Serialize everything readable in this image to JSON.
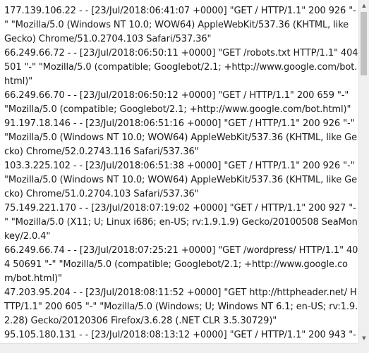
{
  "log": {
    "entries": [
      "177.139.106.22 - - [23/Jul/2018:06:41:07 +0000] \"GET / HTTP/1.1\" 200 926 \"-\" \"Mozilla/5.0 (Windows NT 10.0; WOW64) AppleWebKit/537.36 (KHTML, like Gecko) Chrome/51.0.2704.103 Safari/537.36\"",
      "66.249.66.72 - - [23/Jul/2018:06:50:11 +0000] \"GET /robots.txt HTTP/1.1\" 404 501 \"-\" \"Mozilla/5.0 (compatible; Googlebot/2.1; +http://www.google.com/bot.html)\"",
      "66.249.66.70 - - [23/Jul/2018:06:50:12 +0000] \"GET / HTTP/1.1\" 200 659 \"-\" \"Mozilla/5.0 (compatible; Googlebot/2.1; +http://www.google.com/bot.html)\"",
      "91.197.18.146 - - [23/Jul/2018:06:51:16 +0000] \"GET / HTTP/1.1\" 200 926 \"-\" \"Mozilla/5.0 (Windows NT 10.0; WOW64) AppleWebKit/537.36 (KHTML, like Gecko) Chrome/52.0.2743.116 Safari/537.36\"",
      "103.3.225.102 - - [23/Jul/2018:06:51:38 +0000] \"GET / HTTP/1.1\" 200 926 \"-\" \"Mozilla/5.0 (Windows NT 10.0; WOW64) AppleWebKit/537.36 (KHTML, like Gecko) Chrome/51.0.2704.103 Safari/537.36\"",
      "75.149.221.170 - - [23/Jul/2018:07:19:02 +0000] \"GET / HTTP/1.1\" 200 927 \"-\" \"Mozilla/5.0 (X11; U; Linux i686; en-US; rv:1.9.1.9) Gecko/20100508 SeaMonkey/2.0.4\"",
      "66.249.66.74 - - [23/Jul/2018:07:25:21 +0000] \"GET /wordpress/ HTTP/1.1\" 404 50691 \"-\" \"Mozilla/5.0 (compatible; Googlebot/2.1; +http://www.google.com/bot.html)\"",
      "47.203.95.204 - - [23/Jul/2018:08:11:52 +0000] \"GET http://httpheader.net/ HTTP/1.1\" 200 605 \"-\" \"Mozilla/5.0 (Windows; U; Windows NT 6.1; en-US; rv:1.9.2.28) Gecko/20120306 Firefox/3.6.28 (.NET CLR 3.5.30729)\"",
      "95.105.180.131 - - [23/Jul/2018:08:13:12 +0000] \"GET / HTTP/1.1\" 200 943 \"-\""
    ]
  },
  "scrollbar": {
    "up_arrow_icon": "triangle-up",
    "down_arrow_icon": "triangle-down",
    "up_glyph": "▲",
    "down_glyph": "▼"
  }
}
